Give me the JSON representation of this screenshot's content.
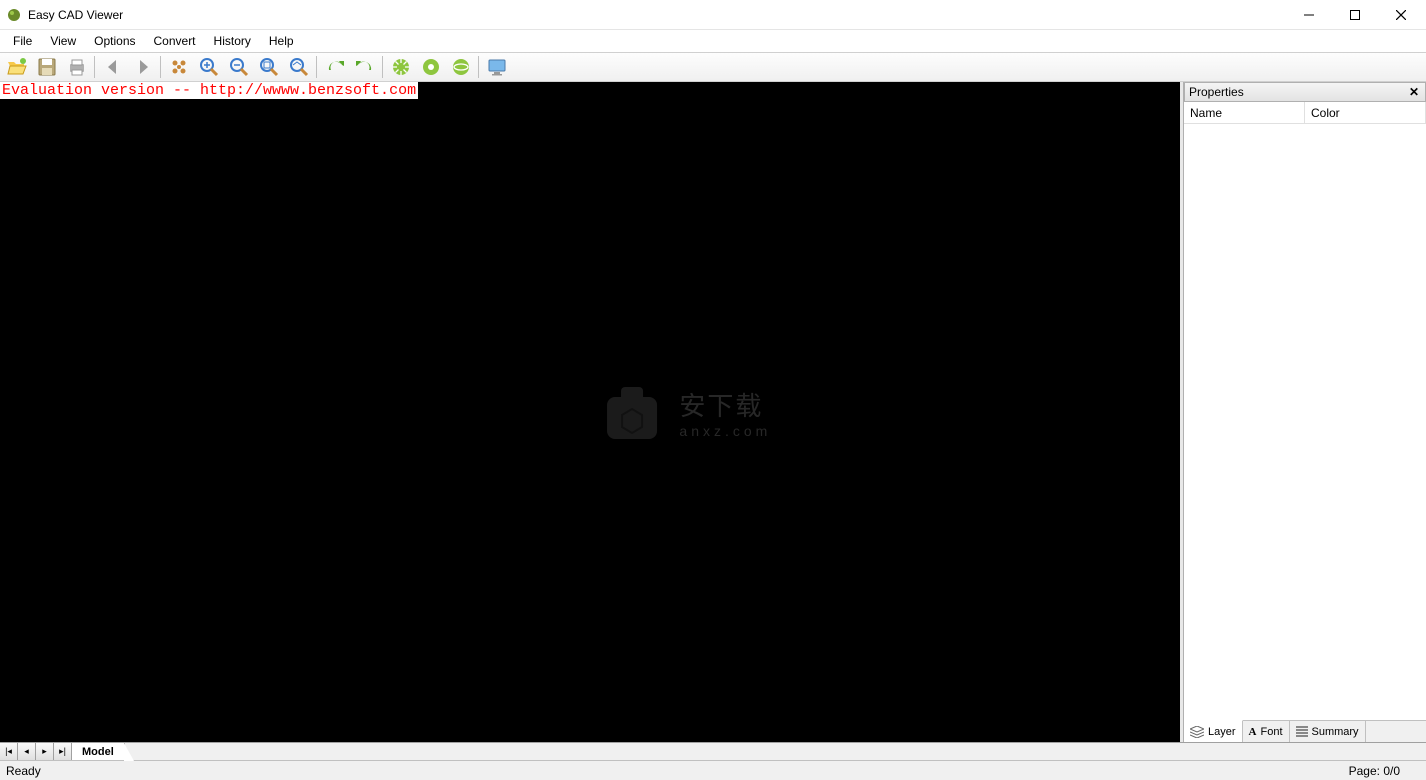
{
  "titlebar": {
    "title": "Easy CAD Viewer"
  },
  "menubar": {
    "items": [
      "File",
      "View",
      "Options",
      "Convert",
      "History",
      "Help"
    ]
  },
  "toolbar": {
    "icons": [
      "open-icon",
      "save-icon",
      "print-icon",
      "sep",
      "back-icon",
      "forward-icon",
      "sep",
      "pan-icon",
      "zoom-in-icon",
      "zoom-out-icon",
      "zoom-extents-icon",
      "zoom-window-icon",
      "sep",
      "redo-icon",
      "undo-icon",
      "sep",
      "rotate-cw-icon",
      "rotate-ccw-icon",
      "rotate-3d-icon",
      "sep",
      "monitor-icon"
    ]
  },
  "canvas": {
    "eval_text": "Evaluation version -- http://wwww.benzsoft.com",
    "watermark_main": "安下载",
    "watermark_sub": "anxz.com"
  },
  "properties": {
    "title": "Properties",
    "columns": [
      "Name",
      "Color"
    ],
    "tabs": [
      {
        "label": "Layer",
        "icon": "layers-icon",
        "active": true
      },
      {
        "label": "Font",
        "icon": "font-icon",
        "active": false
      },
      {
        "label": "Summary",
        "icon": "list-icon",
        "active": false
      }
    ]
  },
  "bottomTabs": {
    "model": "Model"
  },
  "statusbar": {
    "left": "Ready",
    "right": "Page: 0/0"
  }
}
